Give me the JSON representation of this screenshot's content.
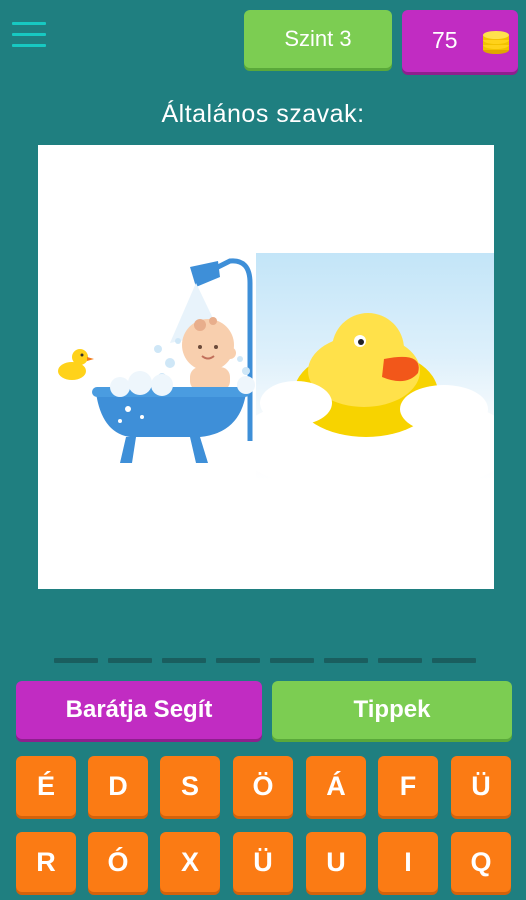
{
  "header": {
    "level_label": "Szint 3",
    "coins": "75"
  },
  "category_label": "Általános szavak:",
  "answer_slot_count": 8,
  "buttons": {
    "friend_help": "Barátja Segít",
    "hints": "Tippek"
  },
  "keyboard": {
    "rows": [
      [
        "É",
        "D",
        "S",
        "Ö",
        "Á",
        "F",
        "Ü"
      ],
      [
        "R",
        "Ó",
        "X",
        "Ü",
        "U",
        "I",
        "Q"
      ]
    ]
  },
  "colors": {
    "background": "#1f7f80",
    "green_button": "#7ccd52",
    "purple_button": "#c12cc2",
    "orange_key": "#fb7b14",
    "menu_icon": "#17c9c2"
  },
  "icons": {
    "menu": "hamburger-menu-icon",
    "coins": "coin-stack-icon"
  }
}
